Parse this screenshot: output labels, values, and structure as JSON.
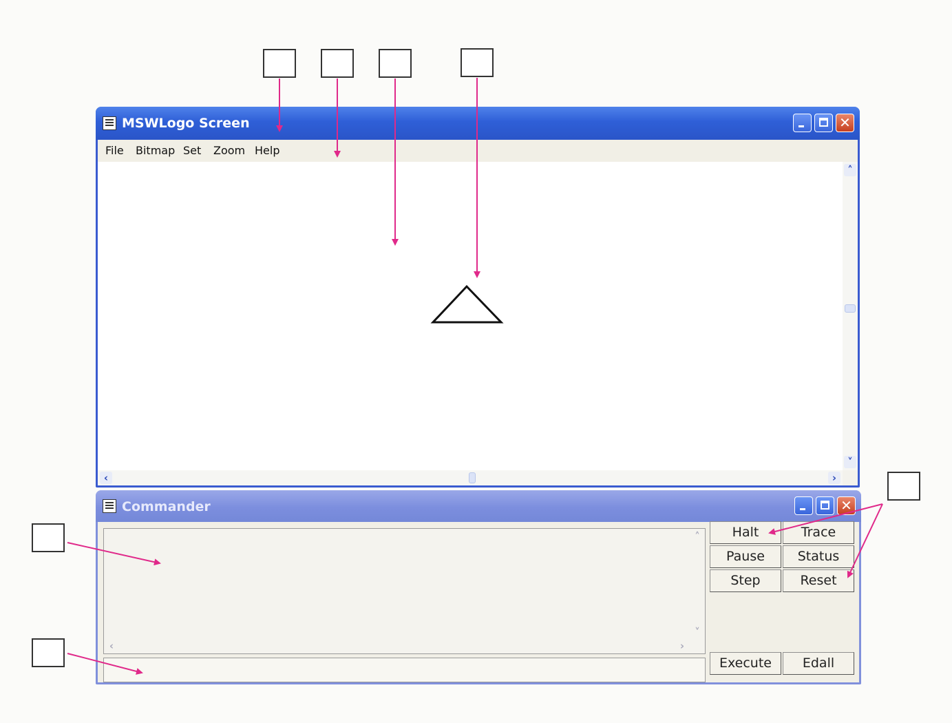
{
  "screen_window": {
    "title": "MSWLogo Screen",
    "menu": [
      "File",
      "Bitmap",
      "Set",
      "Zoom",
      "Help"
    ],
    "buttons": {
      "minimize": "minimize-icon",
      "maximize": "maximize-icon",
      "close": "close-icon"
    }
  },
  "commander_window": {
    "title": "Commander",
    "buttons": [
      [
        "Halt",
        "Trace"
      ],
      [
        "Pause",
        "Status"
      ],
      [
        "Step",
        "Reset"
      ]
    ],
    "execute_label": "Execute",
    "edall_label": "Edall",
    "input_value": ""
  },
  "annotations": {
    "label_boxes": 7,
    "arrow_color": "#e0298a"
  },
  "colors": {
    "title_active": "#2f5fd7",
    "title_inactive": "#7c8ede",
    "window_border": "#3a5bd0"
  }
}
